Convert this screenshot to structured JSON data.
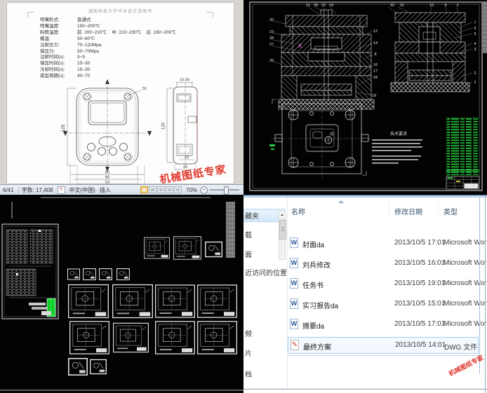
{
  "watermark": {
    "text": "机械图纸专家"
  },
  "word": {
    "header_title": "湖南科技大学毕业设计说明书",
    "specs": [
      {
        "label": "喷嘴形式:",
        "value": "直通式"
      },
      {
        "label": "喷嘴温度:",
        "value": "190~200℃"
      },
      {
        "label": "料筒温度:",
        "value": "前  200~210℃    中  210~230℃    后  160~200℃"
      },
      {
        "label": "模温:",
        "value": "50~80℃"
      },
      {
        "label": "注射压力:",
        "value": "70~120Mpa"
      },
      {
        "label": "保压力:",
        "value": "50~70Mpa"
      },
      {
        "label": "注射时间(s):",
        "value": "3~5"
      },
      {
        "label": "保压时间(s):",
        "value": "15~30"
      },
      {
        "label": "冷却时间(s):",
        "value": "15~30"
      },
      {
        "label": "成型周期(s):",
        "value": "40~70"
      }
    ],
    "drawing_dims": {
      "front_height": "125",
      "width_outer": "65",
      "width_mid": "60",
      "width_inner": "53",
      "screw_dia": "50",
      "side_top": "10.00",
      "side_height": "120",
      "side_depth_inner": "19",
      "side_depth": "22"
    },
    "status": {
      "page": "6/41",
      "word_count": "字数: 17,408",
      "language": "中文(中国)",
      "insert_mode": "插入",
      "zoom_level": "70%"
    }
  },
  "cad_assembly": {
    "notes_title": "技术要求",
    "left_view_callouts": {
      "left": [
        "20",
        "23",
        "28",
        "27",
        "26"
      ],
      "top": [
        "21",
        "30",
        "22",
        "24"
      ],
      "right": [
        "12",
        "14",
        "8",
        "16",
        "17",
        "18",
        "19"
      ]
    },
    "right_view_callouts": {
      "top": [
        "32",
        "31",
        "10",
        "9",
        "2"
      ],
      "right": [
        "7",
        "6",
        "5",
        "4",
        "3",
        "2",
        "1"
      ]
    }
  },
  "explorer": {
    "columns": [
      "名称",
      "修改日期",
      "类型"
    ],
    "sidebar_items": [
      "藏夹",
      "载",
      "面",
      "近访问的位置",
      "频",
      "片",
      "档"
    ],
    "files": [
      {
        "name": "封面da",
        "date": "2013/10/5 17:01",
        "type": "Microsoft Wor"
      },
      {
        "name": "刘兵修改",
        "date": "2013/10/5 16:01",
        "type": "Microsoft Wor"
      },
      {
        "name": "任务书",
        "date": "2013/10/5 19:01",
        "type": "Microsoft Wor"
      },
      {
        "name": "实习报告da",
        "date": "2013/10/5 15:01",
        "type": "Microsoft Wor"
      },
      {
        "name": "摘要da",
        "date": "2013/10/5 17:01",
        "type": "Microsoft Wor"
      },
      {
        "name": "最终方案",
        "date": "2013/10/5 14:01",
        "type": "DWG 文件"
      }
    ]
  },
  "colors": {
    "watermark_red": "#e03a2f",
    "cad_green": "#17dd33",
    "selection_blue": "#a6cdf0"
  }
}
